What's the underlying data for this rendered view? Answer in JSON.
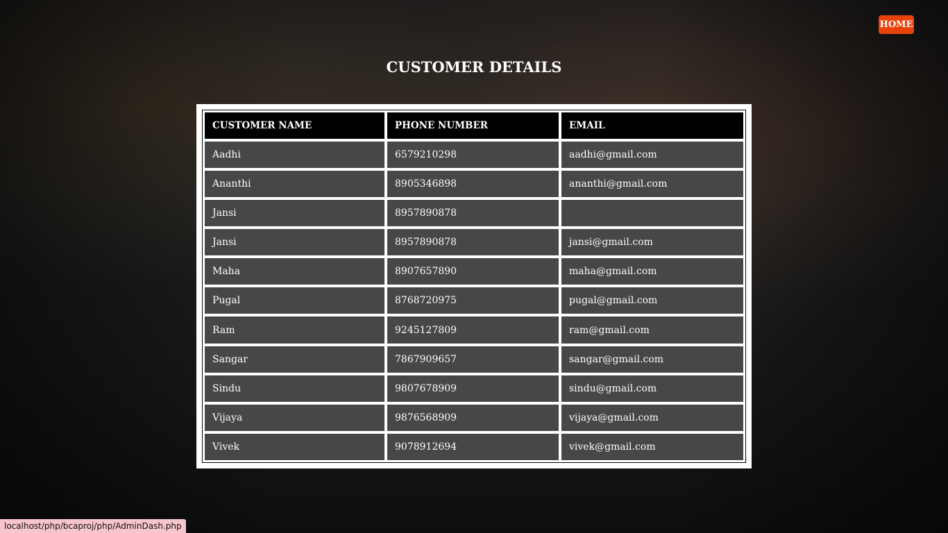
{
  "header": {
    "home_label": "HOME",
    "title": "CUSTOMER DETAILS"
  },
  "table": {
    "columns": [
      "CUSTOMER NAME",
      "PHONE NUMBER",
      "EMAIL"
    ],
    "rows": [
      [
        "Aadhi",
        "6579210298",
        "aadhi@gmail.com"
      ],
      [
        "Ananthi",
        "8905346898",
        "ananthi@gmail.com"
      ],
      [
        "Jansi",
        "8957890878",
        ""
      ],
      [
        "Jansi",
        "8957890878",
        "jansi@gmail.com"
      ],
      [
        "Maha",
        "8907657890",
        "maha@gmail.com"
      ],
      [
        "Pugal",
        "8768720975",
        "pugal@gmail.com"
      ],
      [
        "Ram",
        "9245127809",
        "ram@gmail.com"
      ],
      [
        "Sangar",
        "7867909657",
        "sangar@gmail.com"
      ],
      [
        "Sindu",
        "9807678909",
        "sindu@gmail.com"
      ],
      [
        "Vijaya",
        "9876568909",
        "vijaya@gmail.com"
      ],
      [
        "Vivek",
        "9078912694",
        "vivek@gmail.com"
      ]
    ]
  },
  "status_bar": {
    "url": "localhost/php/bcaproj/php/AdminDash.php"
  },
  "colors": {
    "home_button": "#e8420b",
    "status_bar_bg": "#f7c5cc"
  }
}
